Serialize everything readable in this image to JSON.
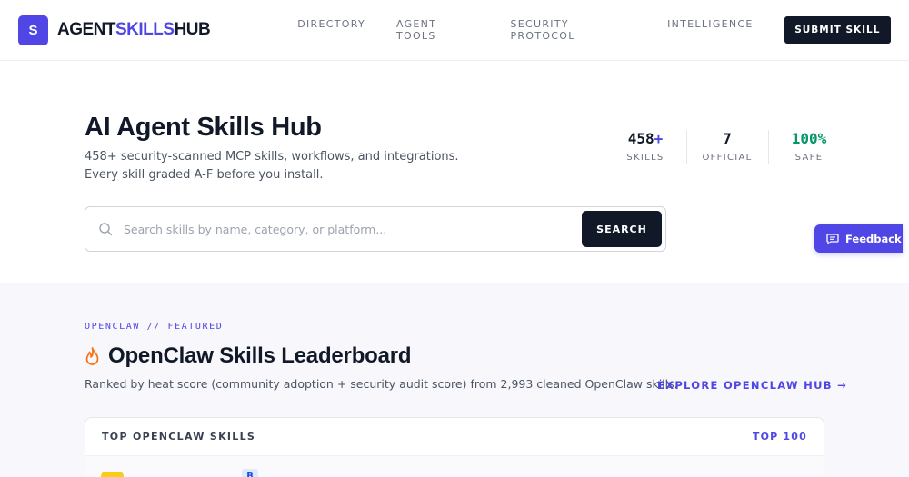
{
  "header": {
    "logo_letter": "S",
    "logo_prefix": "AGENT",
    "logo_accent": "SKILLS",
    "logo_suffix": "HUB",
    "nav": [
      "DIRECTORY",
      "AGENT TOOLS",
      "SECURITY PROTOCOL",
      "INTELLIGENCE"
    ],
    "submit_label": "SUBMIT SKILL"
  },
  "hero": {
    "title": "AI Agent Skills Hub",
    "subtitle": "458+ security-scanned MCP skills, workflows, and integrations. Every skill graded A-F before you install.",
    "stats": [
      {
        "value": "458",
        "suffix": "+",
        "label": "SKILLS"
      },
      {
        "value": "7",
        "suffix": "",
        "label": "OFFICIAL"
      },
      {
        "value": "100%",
        "suffix": "",
        "label": "SAFE"
      }
    ],
    "search": {
      "placeholder": "Search skills by name, category, or platform...",
      "value": "",
      "button_label": "SEARCH"
    }
  },
  "feedback": {
    "label": "Feedback"
  },
  "featured": {
    "eyebrow": "OPENCLAW // FEATURED",
    "title": "OpenClaw Skills Leaderboard",
    "description": "Ranked by heat score (community adoption + security audit score) from 2,993 cleaned OpenClaw skills.",
    "explore_label": "EXPLORE OPENCLAW HUB →",
    "card": {
      "title": "TOP OPENCLAW SKILLS",
      "top_label": "TOP 100",
      "first_row_grade": "B"
    }
  },
  "colors": {
    "accent": "#4f46e5",
    "dark": "#111827",
    "safe_green": "#059669",
    "section_bg": "#f7f7fc"
  },
  "icons": {
    "search": "search-icon",
    "flame": "flame-icon",
    "feedback": "chat-bubble-icon"
  }
}
